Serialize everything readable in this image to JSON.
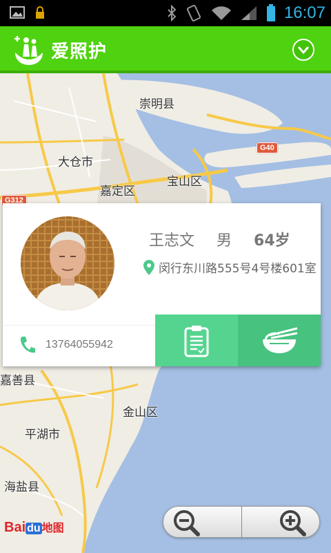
{
  "status_bar": {
    "time": "16:07"
  },
  "app": {
    "title": "爱照护",
    "brand_color": "#4fd20f"
  },
  "map": {
    "labels": {
      "chongming": "崇明县",
      "taicang": "大仓市",
      "baoshan": "宝山区",
      "jiading": "嘉定区",
      "jiashan": "嘉善县",
      "jinshan": "金山区",
      "pinghu": "平湖市",
      "haiyan": "海盐县"
    },
    "roads": {
      "g40": "G40",
      "g312": "G312"
    },
    "provider_logo": {
      "bai": "Bai",
      "du": "du",
      "tu": "地图"
    }
  },
  "profile": {
    "name": "王志文",
    "gender": "男",
    "age": "64岁",
    "address": "闵行东川路555号4号楼601室",
    "phone": "13764055942"
  },
  "actions": {
    "report_color": "#55d490",
    "meal_color": "#48c27f"
  }
}
